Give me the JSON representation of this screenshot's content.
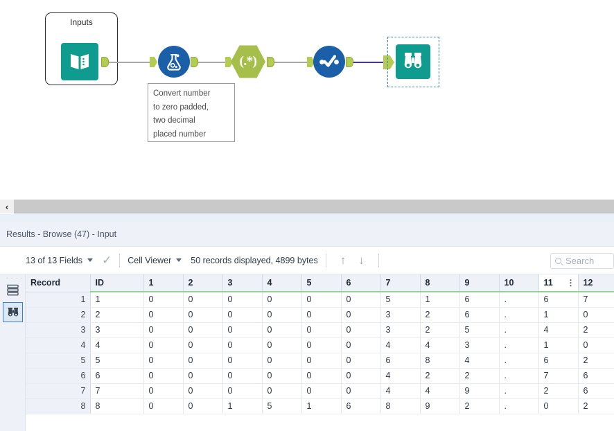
{
  "canvas": {
    "container": {
      "title": "Inputs",
      "icon": "input-data-book-icon"
    },
    "tools": [
      {
        "name": "input-data-tool",
        "icon": "input-data-book-icon",
        "shape": "teal-square"
      },
      {
        "name": "formula-tool",
        "icon": "flask-icon",
        "shape": "blue-circle"
      },
      {
        "name": "regex-tool",
        "icon": "regex-icon",
        "label": "(.*)",
        "shape": "olive-hexagon"
      },
      {
        "name": "select-tool",
        "icon": "checkmark-dots-icon",
        "shape": "blue-circle"
      },
      {
        "name": "browse-tool",
        "icon": "binoculars-icon",
        "shape": "teal-square",
        "selected": true
      }
    ],
    "annotation": {
      "lines": [
        "Convert number",
        "to zero padded,",
        "two decimal",
        "placed number"
      ]
    },
    "colors": {
      "teal": "#0f9b8e",
      "blue": "#1a5fa8",
      "olive": "#a6bf4a",
      "anchor_green": "#b5cc52",
      "wire_gray": "#a8a8a8",
      "wire_selected": "#3c2fd0",
      "selection_dash": "#3b86d0"
    }
  },
  "splitter": {
    "collapse_label": "‹"
  },
  "results": {
    "title": "Results - Browse (47) - Input",
    "toolbar": {
      "fields_label": "13 of 13 Fields",
      "check_icon": "checkmark-icon",
      "view_mode": "Cell Viewer",
      "records_label": "50 records displayed, 4899 bytes",
      "up_arrow": "↑",
      "down_arrow": "↓",
      "search_placeholder": "Search",
      "search_value": ""
    },
    "rail": [
      {
        "name": "rail-table-icon",
        "icon": "table-rows-icon",
        "selected": false
      },
      {
        "name": "rail-browse-icon",
        "icon": "binoculars-icon",
        "selected": true
      }
    ],
    "table": {
      "columns": [
        "Record",
        "ID",
        "1",
        "2",
        "3",
        "4",
        "5",
        "6",
        "7",
        "8",
        "9",
        "10",
        "11",
        "12"
      ],
      "active_column": "11",
      "column_menu_icon": "vertical-dots-icon",
      "rows": [
        [
          "1",
          "1",
          "0",
          "0",
          "0",
          "0",
          "0",
          "0",
          "5",
          "1",
          "6",
          ".",
          "6",
          "7"
        ],
        [
          "2",
          "2",
          "0",
          "0",
          "0",
          "0",
          "0",
          "0",
          "3",
          "2",
          "6",
          ".",
          "1",
          "0"
        ],
        [
          "3",
          "3",
          "0",
          "0",
          "0",
          "0",
          "0",
          "0",
          "3",
          "2",
          "5",
          ".",
          "4",
          "2"
        ],
        [
          "4",
          "4",
          "0",
          "0",
          "0",
          "0",
          "0",
          "0",
          "4",
          "4",
          "3",
          ".",
          "1",
          "0"
        ],
        [
          "5",
          "5",
          "0",
          "0",
          "0",
          "0",
          "0",
          "0",
          "6",
          "8",
          "4",
          ".",
          "6",
          "2"
        ],
        [
          "6",
          "6",
          "0",
          "0",
          "0",
          "0",
          "0",
          "0",
          "4",
          "2",
          "2",
          ".",
          "7",
          "6"
        ],
        [
          "7",
          "7",
          "0",
          "0",
          "0",
          "0",
          "0",
          "0",
          "4",
          "4",
          "9",
          ".",
          "2",
          "6"
        ],
        [
          "8",
          "8",
          "0",
          "0",
          "1",
          "5",
          "1",
          "6",
          "8",
          "9",
          "2",
          ".",
          "0",
          "2"
        ]
      ]
    }
  }
}
